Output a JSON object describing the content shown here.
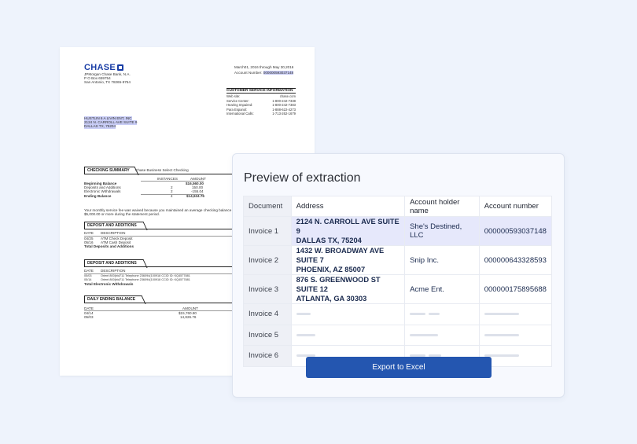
{
  "document": {
    "bank_name": "CHASE",
    "bank_address": [
      "JPMorgan Chase Bank, N.A.",
      "P O Box 659754",
      "San Antonio, TX 78265-9754"
    ],
    "period": "March01, 2016 through May 30,2016",
    "account_label": "Account Number:",
    "account_number": "000000593037148",
    "service_title": "CUSTOMER SERVICE INFORMATION",
    "service_rows": [
      {
        "label": "Web site:",
        "value": "chase.com"
      },
      {
        "label": "Service Center:",
        "value": "1-800-242-7338"
      },
      {
        "label": "Hearing Impaired:",
        "value": "1-800-242-7383"
      },
      {
        "label": "Para Espanol:",
        "value": "1-888-622-4273"
      },
      {
        "label": "International Calls:",
        "value": "1-713-262-1679"
      }
    ],
    "recipient": [
      "HUSTLIN 6 A LIVIN ENT, INC",
      "2124 N. CARROLL AVE SUITE 9",
      "DALLAS TX, 75204"
    ],
    "checking_summary_title": "CHECKING SUMMARY",
    "checking_summary_subtitle": "Chase Business Select Checking",
    "summary_cols": [
      "INSTANCES",
      "AMOUNT"
    ],
    "summary_rows": [
      {
        "label": "Beginning Balance",
        "instances": "",
        "amount": "$16,560.00"
      },
      {
        "label": "Deposits and Additions",
        "instances": "2",
        "amount": "150.00"
      },
      {
        "label": "Electronic Withdrawals",
        "instances": "2",
        "amount": "-155.04"
      },
      {
        "label": "Ending Balance",
        "instances": "4",
        "amount": "$14,624.76"
      }
    ],
    "fee_note_1": "Your monthly service fee was waived because you maintained an average checking balance of $7,5",
    "fee_note_2": "$5,000.00 or more during the statement period.",
    "deposits_title": "DEPOSIT AND ADDITIONS",
    "deposits_cols": [
      "DATE",
      "DESCRIPTION"
    ],
    "deposits_rows": [
      {
        "date": "04/25",
        "desc": "ATM Check Deposit"
      },
      {
        "date": "05/16",
        "desc": "ATM Cash Deposit"
      }
    ],
    "deposits_total": "Total Deposits and Additions",
    "withdrawals_title": "DEPOSIT AND ADDITIONS",
    "withdrawals_cols": [
      "DATE",
      "DESCRIPTION"
    ],
    "withdrawals_rows": [
      {
        "date": "05/03",
        "desc": "Orient 800(hid711 Telephone 236094(100918 CCID ID: KQ4577881"
      },
      {
        "date": "05/14",
        "desc": "Orient 800(hid711 Telephone 236094(100918 CCID ID: KQ4577881"
      }
    ],
    "withdrawals_total": "Total Electronic Withdrawals",
    "daily_title": "DAILY ENDING BALANCE",
    "daily_cols": [
      "DATE",
      "AMOUNT"
    ],
    "daily_rows": [
      {
        "date": "04/14",
        "amount": "$15,760.80"
      },
      {
        "date": "05/03",
        "amount": "14,826.76"
      }
    ]
  },
  "preview": {
    "title": "Preview of extraction",
    "columns": [
      "Document",
      "Address",
      "Account holder name",
      "Account number"
    ],
    "rows": [
      {
        "document": "Invoice 1",
        "address_1": "2124 N. CARROLL AVE SUITE 9",
        "address_2": "DALLAS TX, 75204",
        "name": "She's Destined, LLC",
        "account": "000000593037148",
        "selected": true
      },
      {
        "document": "Invoice 2",
        "address_1": "1432 W. BROADWAY AVE SUITE 7",
        "address_2": "PHOENIX, AZ 85007",
        "name": "Snip Inc.",
        "account": "000000643328593"
      },
      {
        "document": "Invoice 3",
        "address_1": "876 S. GREENWOOD ST SUITE 12",
        "address_2": "ATLANTA, GA 30303",
        "name": "Acme Ent.",
        "account": "000000175895688"
      },
      {
        "document": "Invoice 4"
      },
      {
        "document": "Invoice 5"
      },
      {
        "document": "Invoice 6"
      }
    ],
    "export_label": "Export to Excel",
    "accent": "#2456b0",
    "selected_row_color": "#e6e8fb"
  }
}
